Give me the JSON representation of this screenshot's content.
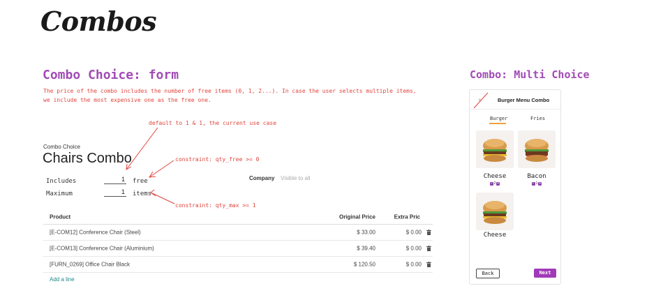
{
  "page": {
    "title": "Combos"
  },
  "combo_form": {
    "section_title": "Combo Choice: form",
    "description_line1": "The price of the combo includes the number of free items (0, 1, 2...). In case the user selects multiple items,",
    "description_line2": "we include the most expensive one as the free one.",
    "annotations": {
      "default": "default to 1 & 1, the current use case",
      "qty_free": "constraint: qty_free >= 0",
      "qty_max": "constraint: qty_max >= 1"
    },
    "breadcrumb": "Combo Choice",
    "record_name": "Chairs Combo",
    "fields": {
      "includes_label": "Includes",
      "includes_value": "1",
      "includes_unit": "free",
      "maximum_label": "Maximum",
      "maximum_value": "1",
      "maximum_unit": "items"
    },
    "company_label": "Company",
    "company_placeholder": "Visible to all",
    "table": {
      "headers": {
        "product": "Product",
        "original_price": "Original Price",
        "extra_price": "Extra Pric"
      },
      "rows": [
        {
          "product": "[E-COM12] Conference Chair (Steel)",
          "original_price": "$ 33.00",
          "extra_price": "$ 0.00"
        },
        {
          "product": "[E-COM13] Conference Chair (Aluminium)",
          "original_price": "$ 39.40",
          "extra_price": "$ 0.00"
        },
        {
          "product": "[FURN_0269] Office Chair Black",
          "original_price": "$ 120.50",
          "extra_price": "$ 0.00"
        }
      ],
      "add_line": "Add a line"
    }
  },
  "multi_choice": {
    "section_title": "Combo: Multi Choice",
    "phone_title": "Burger Menu Combo",
    "close_glyph": "×",
    "tabs": [
      "Burger",
      "Fries"
    ],
    "active_tab": "Burger",
    "items": [
      {
        "name": "Cheese",
        "qty": "2"
      },
      {
        "name": "Bacon",
        "qty": "1"
      },
      {
        "name": "Cheese"
      }
    ],
    "back_label": "Back",
    "next_label": "Next",
    "colors": {
      "next": "#a03bb8",
      "badge": "#8e44ad",
      "tab_underline": "#e8a33c"
    }
  },
  "colors": {
    "section_title": "#a14bb5",
    "annotation": "#e0443c",
    "add_line": "#1a8a8a"
  }
}
